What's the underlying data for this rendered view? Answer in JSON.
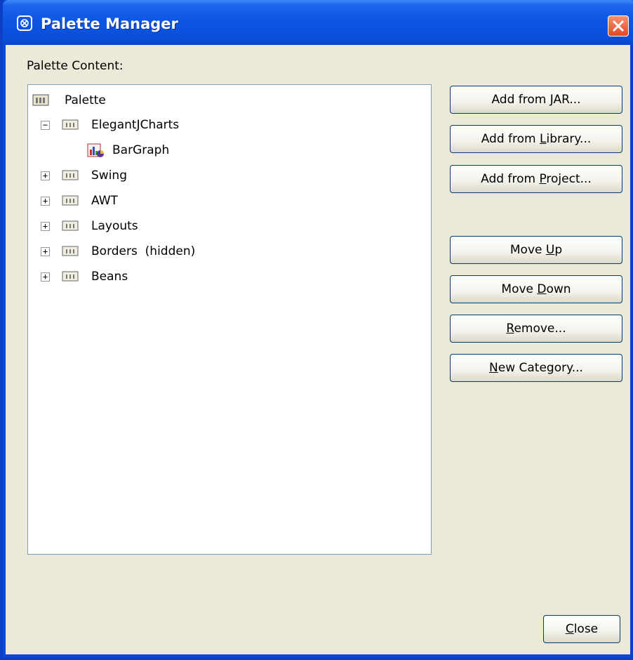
{
  "window": {
    "title": "Palette Manager"
  },
  "palette_content_label": "Palette Content:",
  "tree": {
    "root": "Palette",
    "categories": [
      {
        "label": "ElegantJCharts",
        "expanded": true,
        "children": [
          "BarGraph"
        ]
      },
      {
        "label": "Swing",
        "expanded": false
      },
      {
        "label": "AWT",
        "expanded": false
      },
      {
        "label": "Layouts",
        "expanded": false
      },
      {
        "label": "Borders  (hidden)",
        "expanded": false
      },
      {
        "label": "Beans",
        "expanded": false
      }
    ]
  },
  "buttons": {
    "add_from_jar": {
      "pre": "Add from ",
      "ul": "J",
      "post": "AR..."
    },
    "add_from_library": {
      "pre": "Add from ",
      "ul": "L",
      "post": "ibrary..."
    },
    "add_from_project": {
      "pre": "Add from ",
      "ul": "P",
      "post": "roject..."
    },
    "move_up": {
      "pre": "Move ",
      "ul": "U",
      "post": "p"
    },
    "move_down": {
      "pre": "Move ",
      "ul": "D",
      "post": "own"
    },
    "remove": {
      "pre": "",
      "ul": "R",
      "post": "emove..."
    },
    "new_category": {
      "pre": "",
      "ul": "N",
      "post": "ew Category..."
    },
    "close": {
      "pre": "",
      "ul": "C",
      "post": "lose"
    }
  },
  "icons": {
    "app": "palette-app-icon",
    "close": "close-x-icon",
    "category": "palette-category-icon",
    "bean": "bargraph-bean-icon"
  },
  "colors": {
    "titlebar": "#0a4fd9",
    "close_button": "#e14a24",
    "dialog_bg": "#ece9d8",
    "tree_border": "#7f9db9",
    "button_border": "#003c74"
  }
}
